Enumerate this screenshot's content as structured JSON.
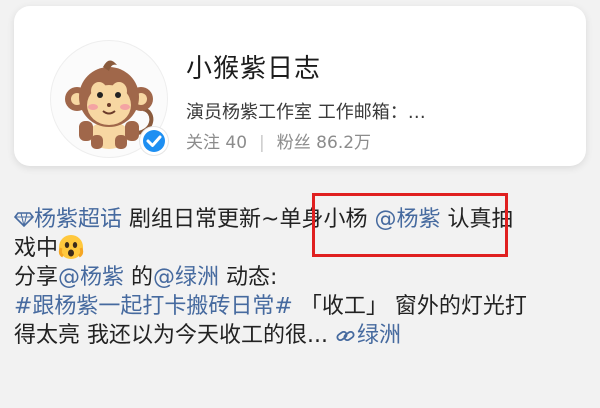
{
  "profile": {
    "name": "小猴紫日志",
    "description": "演员杨紫工作室 工作邮箱：…",
    "following_label": "关注 40",
    "separator": "|",
    "followers_label": "粉丝 86.2万",
    "avatar": "monkey-avatar",
    "verified_badge": "verified-check-icon"
  },
  "post": {
    "supertopic": "杨紫超话",
    "text1": " 剧组日常更新~",
    "mention_text": "单身小杨 ",
    "mention1": "@杨紫",
    "text2": " 认真拍",
    "text3": "戏中",
    "share_prefix": "分享",
    "mention2": "@杨紫",
    "share_mid": " 的",
    "mention3": "@绿洲",
    "share_suffix": " 动态:",
    "hashtag": "#跟杨紫一起打卡搬砖日常#",
    "text4": " 「收工」 窗外的灯光打",
    "text5": "得太亮 我还以为今天收工的很... ",
    "app_link": "绿洲"
  },
  "colors": {
    "link": "#466a9f",
    "highlight_box": "#e02020",
    "verified": "#1e8ff2"
  }
}
